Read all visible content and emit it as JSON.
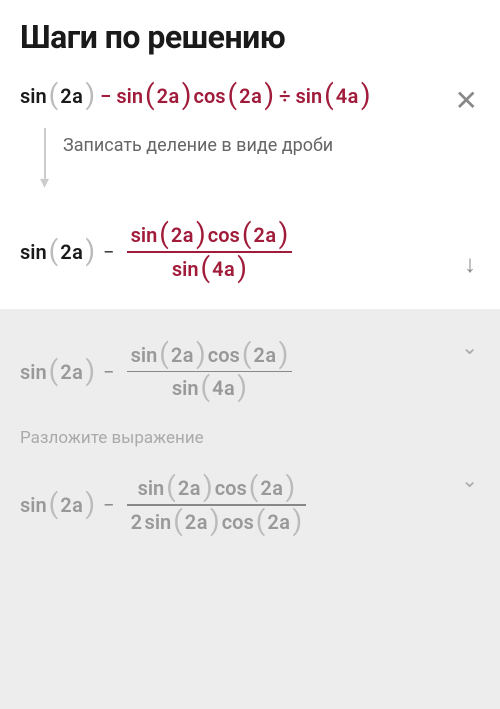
{
  "title": "Шаги по решению",
  "icons": {
    "close": "✕",
    "down": "↓",
    "chevron": "⌄"
  },
  "expr": {
    "sin": "sin",
    "cos": "cos",
    "arg2a": "2a",
    "arg4a": "4a",
    "minus": "−",
    "divide": "÷",
    "two": "2"
  },
  "explain1": "Записать деление в виде дроби",
  "explain2": "Разложите выражение"
}
